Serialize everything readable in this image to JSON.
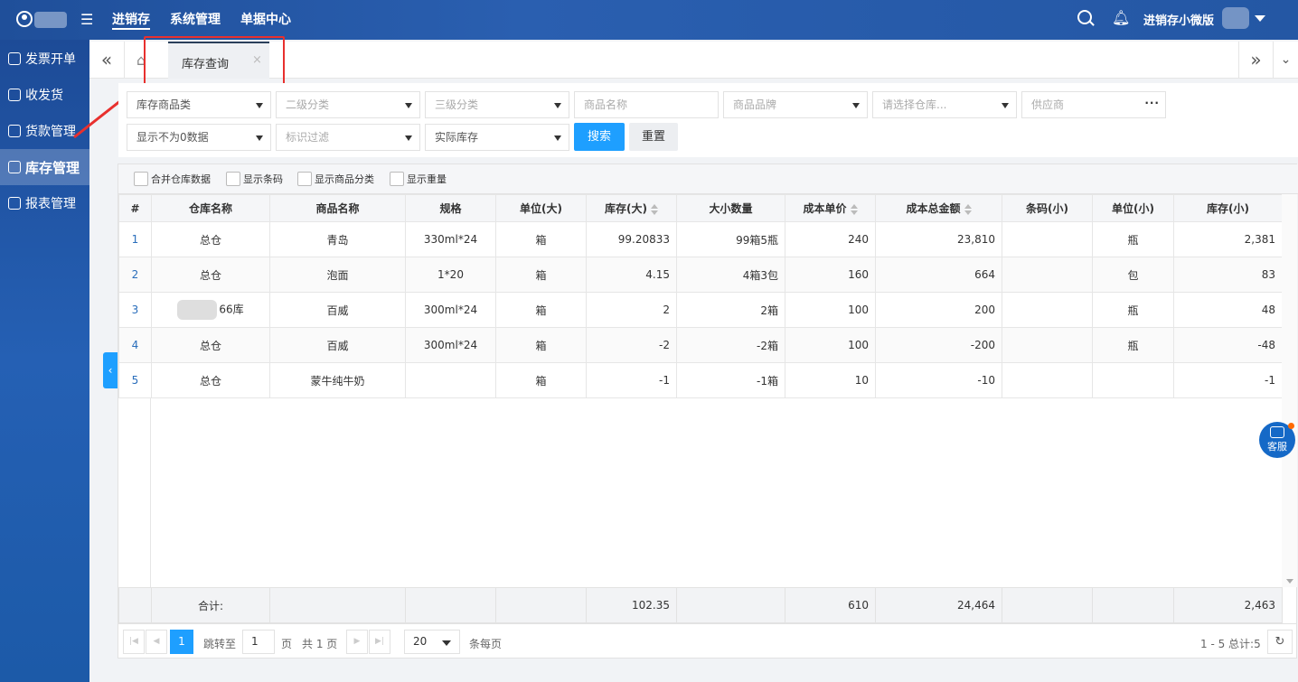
{
  "topbar": {
    "nav": [
      "进销存",
      "系统管理",
      "单据中心"
    ],
    "active_nav": "进销存",
    "account": "进销存小微版"
  },
  "sidebar": {
    "items": [
      {
        "label": "发票开单",
        "icon": "invoice-icon"
      },
      {
        "label": "收发货",
        "icon": "truck-icon"
      },
      {
        "label": "货款管理",
        "icon": "money-icon"
      },
      {
        "label": "库存管理",
        "icon": "layers-icon",
        "active": true
      },
      {
        "label": "报表管理",
        "icon": "report-icon"
      }
    ]
  },
  "tabs": {
    "current": "库存查询",
    "close": "×"
  },
  "filters": {
    "category1": "库存商品类",
    "category2": "二级分类",
    "category3": "三级分类",
    "product_name": "商品名称",
    "brand": "商品品牌",
    "warehouse": "请选择仓库...",
    "supplier": "供应商",
    "nonzero": "显示不为0数据",
    "tag_filter": "标识过滤",
    "stock_type": "实际库存",
    "search_label": "搜索",
    "reset_label": "重置"
  },
  "options": {
    "merge_warehouse": "合并仓库数据",
    "show_barcode": "显示条码",
    "show_category": "显示商品分类",
    "show_weight": "显示重量"
  },
  "table": {
    "columns": [
      "#",
      "仓库名称",
      "商品名称",
      "规格",
      "单位(大)",
      "库存(大)",
      "大小数量",
      "成本单价",
      "成本总金额",
      "条码(小)",
      "单位(小)",
      "库存(小)"
    ],
    "rows": [
      [
        "1",
        "总仓",
        "青岛",
        "330ml*24",
        "箱",
        "99.20833",
        "99箱5瓶",
        "240",
        "23,810",
        "",
        "瓶",
        "2,381"
      ],
      [
        "2",
        "总仓",
        "泡面",
        "1*20",
        "箱",
        "4.15",
        "4箱3包",
        "160",
        "664",
        "",
        "包",
        "83"
      ],
      [
        "3",
        "66库",
        "百威",
        "300ml*24",
        "箱",
        "2",
        "2箱",
        "100",
        "200",
        "",
        "瓶",
        "48"
      ],
      [
        "4",
        "总仓",
        "百威",
        "300ml*24",
        "箱",
        "-2",
        "-2箱",
        "100",
        "-200",
        "",
        "瓶",
        "-48"
      ],
      [
        "5",
        "总仓",
        "蒙牛纯牛奶",
        "",
        "箱",
        "-1",
        "-1箱",
        "10",
        "-10",
        "",
        "",
        "-1"
      ]
    ],
    "footer": {
      "label": "合计:",
      "stock_big": "102.35",
      "unit_cost": "610",
      "total_cost": "24,464",
      "stock_small": "2,463"
    }
  },
  "pager": {
    "current_page": "1",
    "jump_label": "跳转至",
    "jump_value": "1",
    "page_unit": "页",
    "total_pages": "共 1 页",
    "page_size": "20",
    "per_page_label": "条每页",
    "summary": "1 - 5 总计:5"
  },
  "service": {
    "label": "客服"
  },
  "colors": {
    "primary": "#1e9fff",
    "topbar": "#2457a4",
    "highlight_box": "#e8302e"
  }
}
